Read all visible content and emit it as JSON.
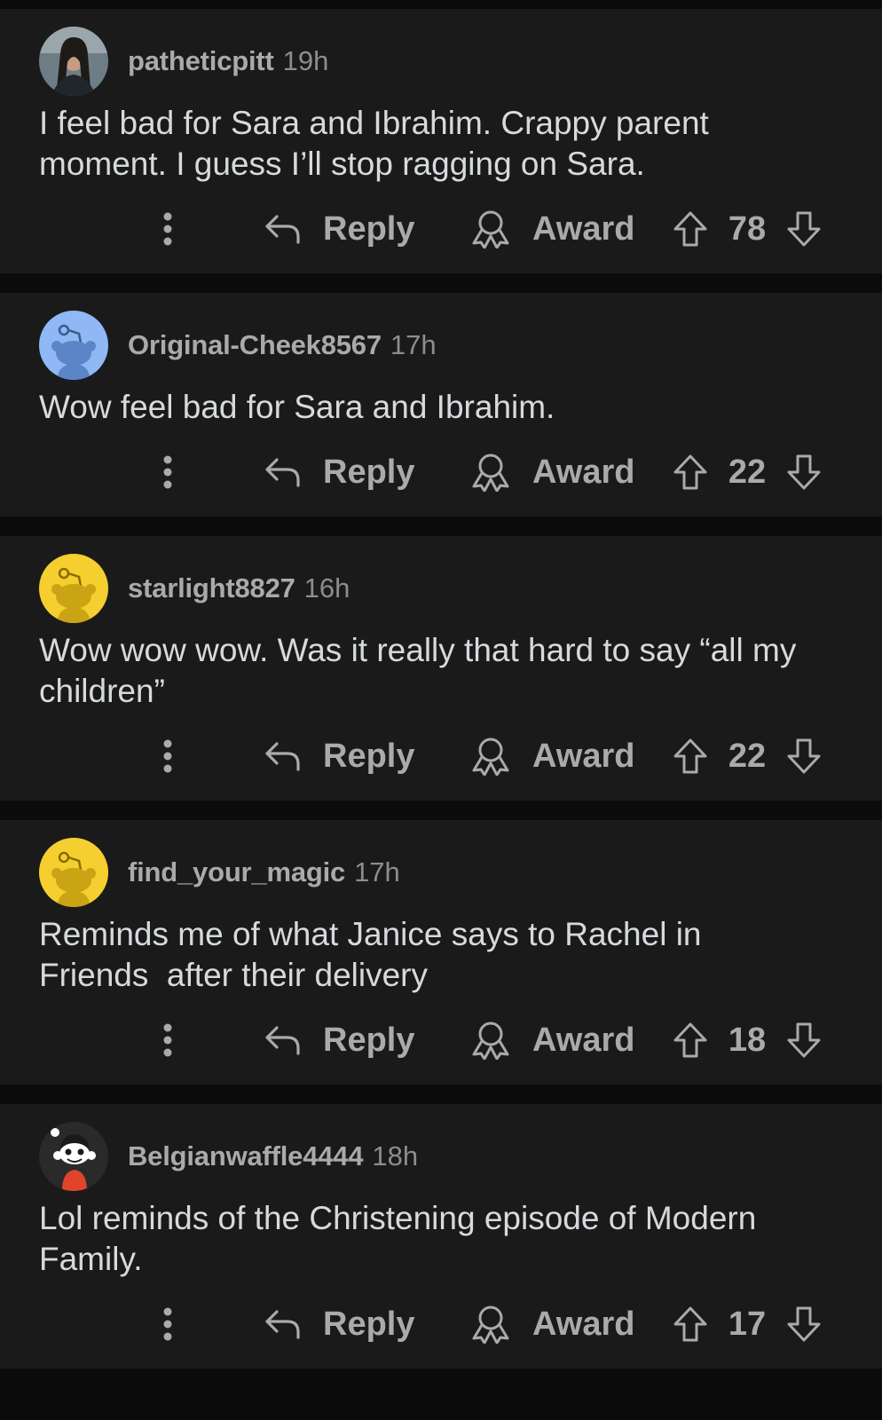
{
  "comments": [
    {
      "username": "patheticpitt",
      "age": "19h",
      "text": "I feel bad for Sara and Ibrahim. Crappy parent\nmoment. I guess I’ll stop ragging on Sara.",
      "score": "78",
      "avatar": "photo-avatar"
    },
    {
      "username": "Original-Cheek8567",
      "age": "17h",
      "text": "Wow feel bad for Sara and Ibrahim.",
      "score": "22",
      "avatar": "snoo-blue"
    },
    {
      "username": "starlight8827",
      "age": "16h",
      "text": "Wow wow wow. Was it really that hard to say “all my\nchildren”",
      "score": "22",
      "avatar": "snoo-yellow"
    },
    {
      "username": "find_your_magic",
      "age": "17h",
      "text": "Reminds me of what Janice says to Rachel in\nFriends  after their delivery",
      "score": "18",
      "avatar": "snoo-yellow"
    },
    {
      "username": "Belgianwaffle4444",
      "age": "18h",
      "text": "Lol reminds of the Christening episode of Modern\nFamily.",
      "score": "17",
      "avatar": "custom-snoo"
    }
  ],
  "actions": {
    "reply_label": "Reply",
    "award_label": "Award"
  },
  "colors": {
    "background": "#0b0b0b",
    "card": "#1a1a1b",
    "text": "#d7dadc",
    "muted": "#a8aaab",
    "avatar_blue": "#8fb8f5",
    "avatar_yellow": "#f5cf2f"
  },
  "icons": {
    "more": "vertical-dots-icon",
    "reply": "reply-arrow-icon",
    "award": "award-ribbon-icon",
    "upvote": "arrow-up-icon",
    "downvote": "arrow-down-icon"
  }
}
